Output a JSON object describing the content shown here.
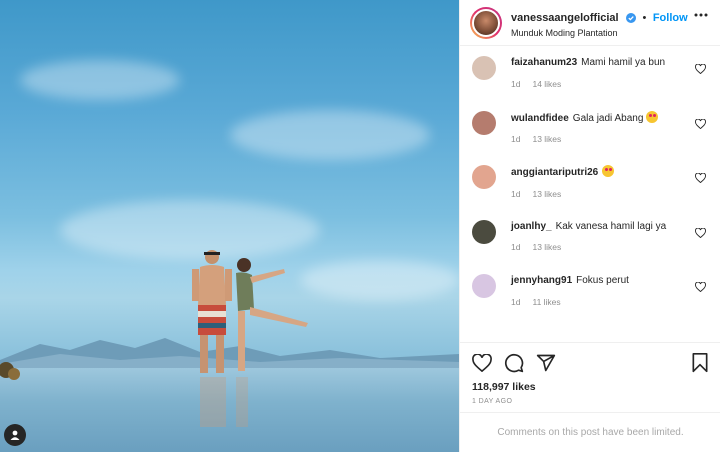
{
  "post": {
    "username": "vanessaangelofficial",
    "dot": "•",
    "follow_label": "Follow",
    "location": "Munduk Moding Plantation"
  },
  "comments": [
    {
      "user": "faizahanum23",
      "text": "Mami hamil ya bun",
      "time": "1d",
      "likes": "14 likes",
      "avatar_color": "#d9c2b4"
    },
    {
      "user": "wulandfidee",
      "text": "Gala jadi Abang",
      "emoji": true,
      "time": "1d",
      "likes": "13 likes",
      "avatar_color": "#b57c6e"
    },
    {
      "user": "anggiantariputri26",
      "text": "",
      "emoji": true,
      "time": "1d",
      "likes": "13 likes",
      "avatar_color": "#e2a58f"
    },
    {
      "user": "joanlhy_",
      "text": "Kak vanesa hamil lagi ya",
      "time": "1d",
      "likes": "13 likes",
      "avatar_color": "#4b4b3f"
    },
    {
      "user": "jennyhang91",
      "text": "Fokus perut",
      "time": "1d",
      "likes": "11 likes",
      "avatar_color": "#d8c6e2"
    }
  ],
  "actions": {
    "likes_count": "118,997 likes",
    "date": "1 DAY AGO",
    "comments_limited": "Comments on this post have been limited."
  },
  "colors": {
    "accent": "#0095f6",
    "text": "#262626",
    "muted": "#8e8e8e"
  },
  "icons": {
    "more": "more-horizontal-icon",
    "like": "heart-icon",
    "comment": "comment-icon",
    "share": "paper-plane-icon",
    "save": "bookmark-icon",
    "tag": "user-tag-icon"
  }
}
